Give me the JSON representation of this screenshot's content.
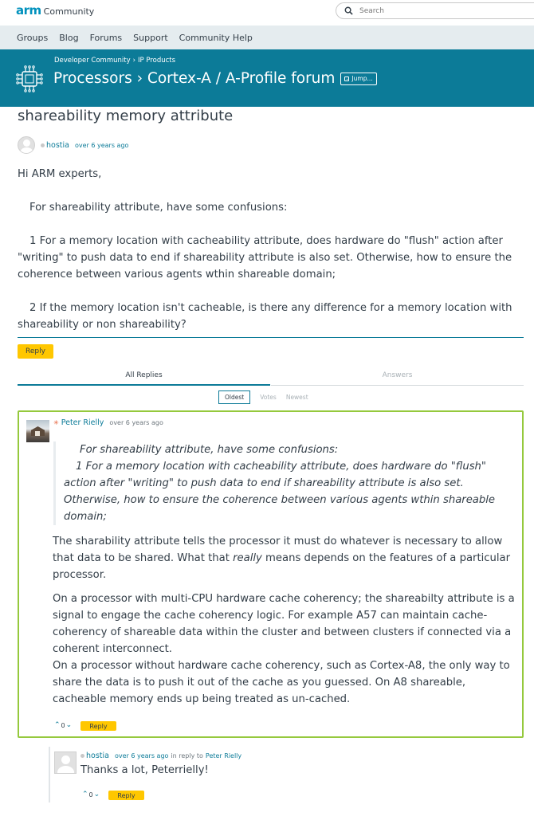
{
  "header": {
    "logo_brand": "arm",
    "logo_text": "Community",
    "search_placeholder": "Search"
  },
  "nav": [
    "Groups",
    "Blog",
    "Forums",
    "Support",
    "Community Help"
  ],
  "banner": {
    "breadcrumb": [
      "Developer Community",
      "IP Products"
    ],
    "breadcrumb_sep": "›",
    "title": "Processors › Cortex-A / A-Profile forum",
    "jump_label": "Jump..."
  },
  "question": {
    "title": "shareability memory attribute",
    "author": "hostia",
    "time": "over 6 years ago",
    "paragraphs": [
      "Hi ARM experts,",
      "For shareability attribute, have some confusions:",
      "1 For a memory location with cacheability attribute, does hardware do \"flush\" action after \"writing\" to push data to end if shareability attribute is also set. Otherwise, how to ensure the coherence between various agents wthin shareable domain;",
      "2 If the memory location isn't cacheable, is there any difference for a memory location with shareability or non shareability?"
    ],
    "reply_label": "Reply"
  },
  "tabs": {
    "all": "All Replies",
    "answers": "Answers"
  },
  "sort": [
    "Oldest",
    "Votes",
    "Newest"
  ],
  "answer": {
    "author": "Peter Rielly",
    "time": "over 6 years ago",
    "quote": [
      "For shareability attribute, have some confusions:",
      "1 For a memory location with cacheability attribute, does hardware do \"flush\" action after \"writing\" to push data to end if shareability attribute is also set. Otherwise, how to ensure the coherence between various agents wthin shareable domain;"
    ],
    "p1_before": "The sharability attribute tells the processor it must do whatever is necessary to allow that data to be shared.  What that ",
    "p1_em": "really",
    "p1_after": " means depends on the features of a particular processor.",
    "p2": "On a processor with multi-CPU hardware cache coherency; the shareabilty attribute is a signal to engage the cache coherency logic.  For example A57 can maintain cache-coherency of shareable data within the cluster and between clusters if connected via a coherent interconnect.",
    "p3": "On a processor without hardware cache coherency, such as Cortex-A8, the only way to share the data is to push it out of the cache as you guessed.  On A8 shareable, cacheable memory ends up being treated as un-cached.",
    "votes": "0",
    "reply_label": "Reply"
  },
  "nested_reply": {
    "author": "hostia",
    "time": "over 6 years ago",
    "in_reply_to": "in reply to",
    "parent_author": "Peter Rielly",
    "text": "Thanks a lot, Peterrielly!",
    "votes": "0",
    "reply_label": "Reply"
  },
  "colors": {
    "brand": "#0091bd",
    "banner": "#0c7b98",
    "accent_button": "#ffc700",
    "answer_border": "#95c93d"
  }
}
